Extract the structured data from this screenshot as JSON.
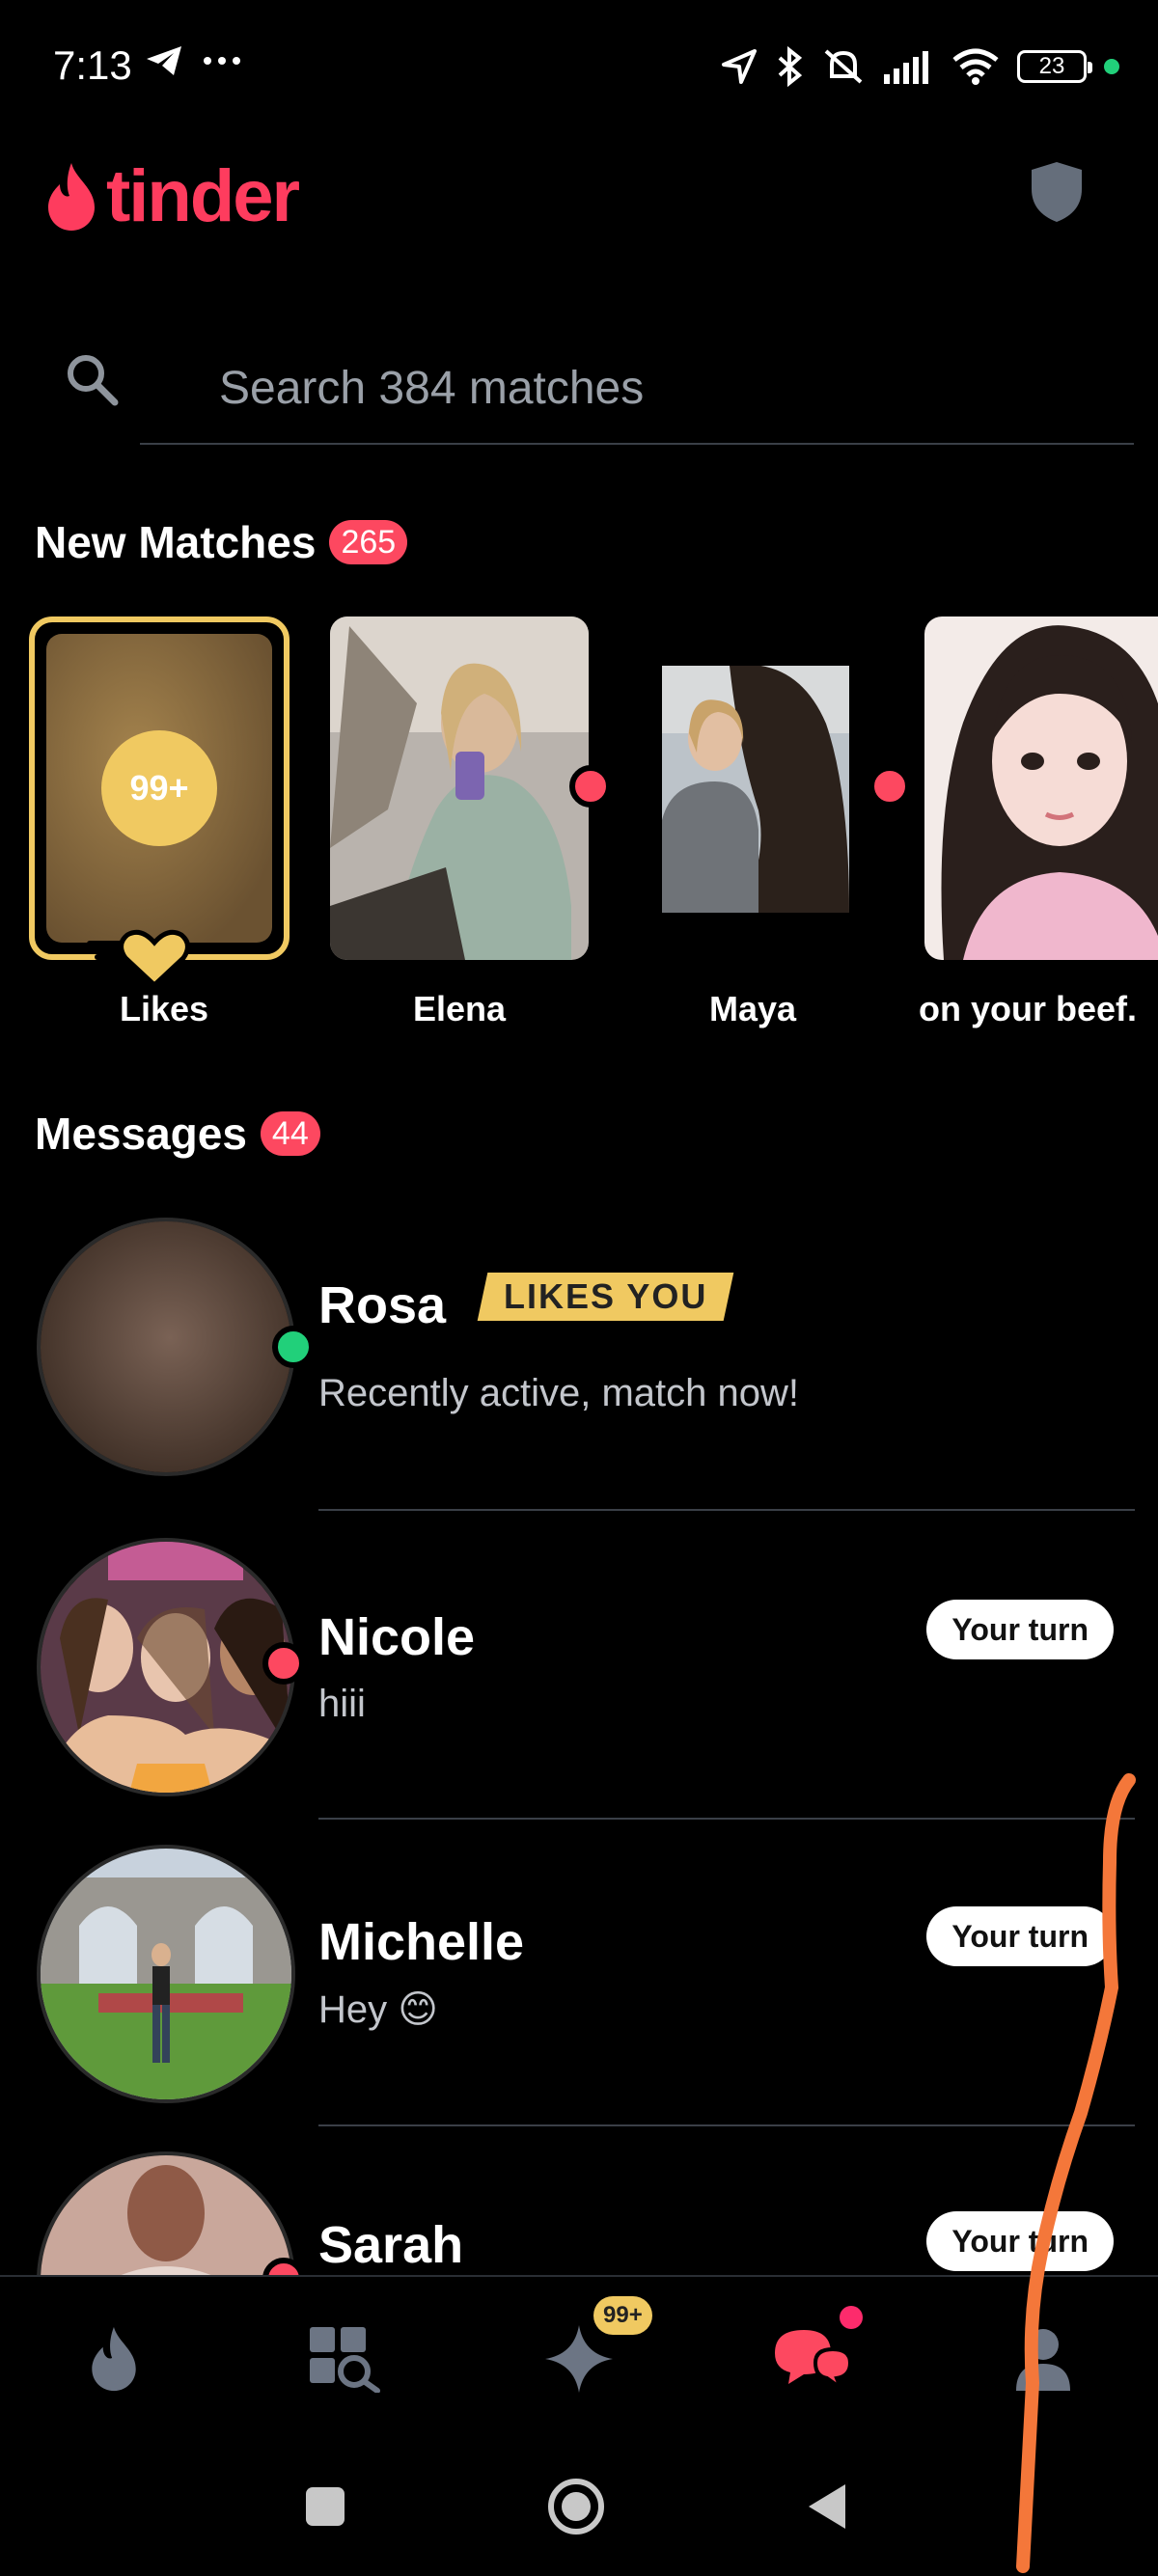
{
  "status_bar": {
    "time": "7:13",
    "battery": "23"
  },
  "app": {
    "brand": "tinder",
    "brand_color": "#fe3c5e"
  },
  "search": {
    "placeholder": "Search 384 matches"
  },
  "new_matches": {
    "title": "New Matches",
    "count": "265",
    "likes_label": "Likes",
    "likes_count": "99+",
    "items": [
      {
        "name": "Elena"
      },
      {
        "name": "Maya"
      },
      {
        "name": "on your beef."
      }
    ]
  },
  "messages": {
    "title": "Messages",
    "count": "44",
    "items": [
      {
        "name": "Rosa",
        "tag": "LIKES YOU",
        "text": "Recently active, match now!",
        "status": "online"
      },
      {
        "name": "Nicole",
        "text": "hiii",
        "action": "Your turn",
        "status": "new"
      },
      {
        "name": "Michelle",
        "text": "Hey 😊",
        "action": "Your turn"
      },
      {
        "name": "Sarah",
        "text": "",
        "action": "Your turn",
        "status": "new"
      }
    ]
  },
  "tab_bar": {
    "items": [
      "swipe-tab",
      "explore-tab",
      "gold-tab",
      "messages-tab",
      "profile-tab"
    ],
    "gold_badge": "99+",
    "active": "messages-tab"
  },
  "colors": {
    "accent": "#fd4860",
    "gold": "#f0c961",
    "online": "#21d07a"
  }
}
